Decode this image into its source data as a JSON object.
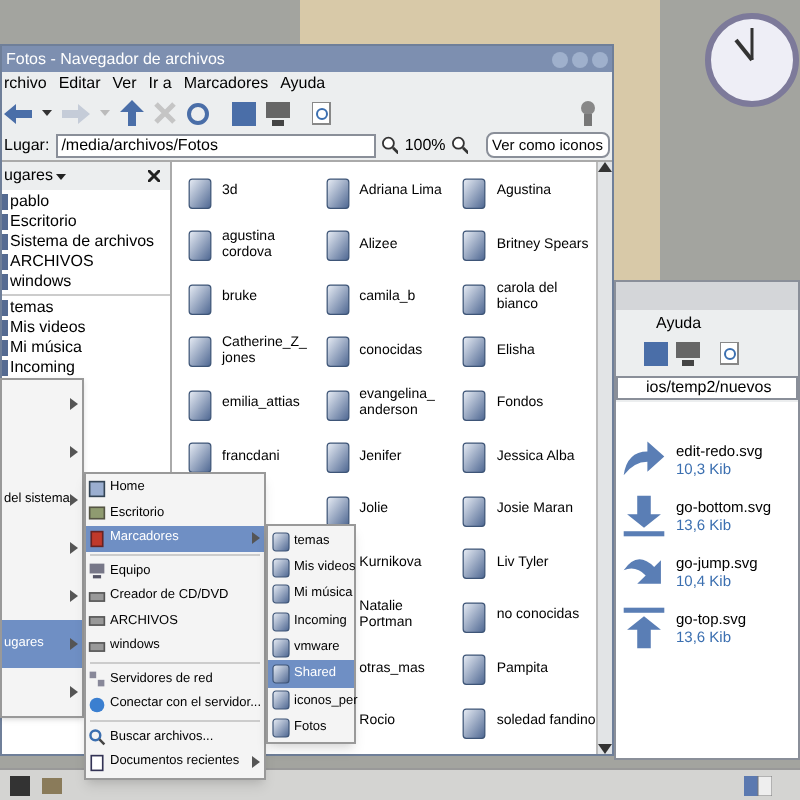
{
  "main_window": {
    "title": "Fotos - Navegador de archivos",
    "menu": [
      "rchivo",
      "Editar",
      "Ver",
      "Ir a",
      "Marcadores",
      "Ayuda"
    ],
    "location_label": "Lugar:",
    "location": "/media/archivos/Fotos",
    "zoom": "100%",
    "view_mode": "Ver como iconos",
    "sidebar": {
      "title": "ugares",
      "groups": [
        [
          "pablo",
          "Escritorio",
          "Sistema de archivos",
          "ARCHIVOS",
          "windows"
        ],
        [
          "temas",
          "Mis videos",
          "Mi música",
          "Incoming"
        ]
      ]
    },
    "folder_rows": [
      [
        "3d",
        "Adriana Lima",
        "Agustina"
      ],
      [
        "agustina cordova",
        "Alizee",
        "Britney Spears"
      ],
      [
        "bruke",
        "camila_b",
        "carola del bianco"
      ],
      [
        "Catherine_Z_ jones",
        "conocidas",
        "Elisha"
      ],
      [
        "emilia_attias",
        "evangelina_ anderson",
        "Fondos"
      ],
      [
        "francdani",
        "Jenifer",
        "Jessica Alba"
      ],
      [
        "Jolie",
        "Josie Maran"
      ],
      [
        "Kurnikova",
        "Liv Tyler"
      ],
      [
        "Natalie Portman",
        "no conocidas"
      ],
      [
        "otras_mas",
        "Pampita"
      ],
      [
        "Rocio",
        "soledad fandino"
      ]
    ]
  },
  "second_window": {
    "menu": [
      "Ayuda"
    ],
    "location": "ios/temp2/nuevos",
    "files": [
      {
        "name": "edit-redo.svg",
        "size": "10,3 Kib",
        "kind": "redo"
      },
      {
        "name": "go-bottom.svg",
        "size": "13,6 Kib",
        "kind": "bottom"
      },
      {
        "name": "go-jump.svg",
        "size": "10,4 Kib",
        "kind": "jump"
      },
      {
        "name": "go-top.svg",
        "size": "13,6 Kib",
        "kind": "top"
      }
    ]
  },
  "main_menu": [
    {
      "selected": false
    },
    {
      "selected": false
    },
    {
      "label": "del sistema",
      "selected": false
    },
    {
      "selected": false
    },
    {
      "selected": false
    },
    {
      "label": "ugares",
      "selected": true
    },
    {
      "selected": false
    }
  ],
  "places_menu": [
    {
      "kind": "home",
      "label": "Home",
      "selected": false
    },
    {
      "kind": "desktop",
      "label": "Escritorio",
      "selected": false
    },
    {
      "kind": "bookmarks",
      "label": "Marcadores",
      "selected": true,
      "submenu": true
    },
    {
      "kind": "separator"
    },
    {
      "kind": "computer",
      "label": "Equipo",
      "selected": false
    },
    {
      "kind": "drive",
      "label": "Creador de CD/DVD",
      "selected": false
    },
    {
      "kind": "drive",
      "label": "ARCHIVOS",
      "selected": false
    },
    {
      "kind": "drive",
      "label": "windows",
      "selected": false
    },
    {
      "kind": "separator"
    },
    {
      "kind": "network",
      "label": "Servidores de red",
      "selected": false
    },
    {
      "kind": "globe",
      "label": "Conectar con el servidor...",
      "selected": false
    },
    {
      "kind": "separator"
    },
    {
      "kind": "search",
      "label": "Buscar archivos...",
      "selected": false
    },
    {
      "kind": "recent",
      "label": "Documentos recientes",
      "selected": false,
      "submenu": true
    }
  ],
  "bookmarks_menu": [
    {
      "label": "temas",
      "selected": false
    },
    {
      "label": "Mis videos",
      "selected": false
    },
    {
      "label": "Mi música",
      "selected": false
    },
    {
      "label": "Incoming",
      "selected": false
    },
    {
      "label": "vmware",
      "selected": false
    },
    {
      "label": "Shared",
      "selected": true
    },
    {
      "label": "iconos_per",
      "selected": false
    },
    {
      "label": "Fotos",
      "selected": false
    }
  ]
}
